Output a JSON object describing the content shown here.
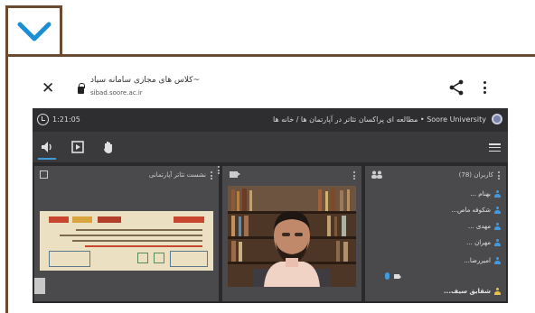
{
  "page": {
    "expand_icon": "chevron-down-icon"
  },
  "browser": {
    "close_icon": "close-icon",
    "lock_icon": "lock-icon",
    "page_title": "کلاس های مجازی سامانه سیاد~",
    "url": "sibad.soore.ac.ir",
    "share_icon": "share-icon",
    "menu_icon": "kebab-menu-icon"
  },
  "session": {
    "clock_icon": "clock-icon",
    "timer": "1:21:05",
    "course_title": "Soore University • مطالعه ای پراکسان تئاتر در آپارتمان ها / خانه ها",
    "logo_icon": "university-logo-icon"
  },
  "toolbar": {
    "items": [
      "speaker-icon",
      "screen-share-icon",
      "raise-hand-icon"
    ],
    "menu_icon": "hamburger-menu-icon"
  },
  "slides_panel": {
    "title": "نشست تئاتر آپارتمانی",
    "icon": "presentation-icon",
    "slide_lines": [
      "سلسله نشست های تخصصی",
      "مطالعه ای پراکسان تئاتر در آپارتمان ها / خانه ها",
      "مقدمه ای بر رویکردهای نوین آموزش آکادمیک تئاتر در ایران و جهان"
    ]
  },
  "video_panel": {
    "icon": "camera-icon"
  },
  "users_panel": {
    "title": "کاربران (78)",
    "icon": "users-icon",
    "users": [
      {
        "name": "بهنام ...",
        "role": "viewer"
      },
      {
        "name": "شکوفه ماص...",
        "role": "viewer"
      },
      {
        "name": "مهدی ...",
        "role": "viewer"
      },
      {
        "name": "مهران ...",
        "role": "viewer"
      },
      {
        "name": "امیررضا...",
        "role": "viewer"
      },
      {
        "name": "شقایق سیف...",
        "role": "moderator"
      }
    ],
    "mic_icon": "microphone-icon",
    "cam_icon": "webcam-icon"
  },
  "colors": {
    "accent_blue": "#3f9ae0",
    "frame_brown": "#6b4a30",
    "moderator_gold": "#e8c34a",
    "chevron_blue": "#1a8fd6"
  }
}
